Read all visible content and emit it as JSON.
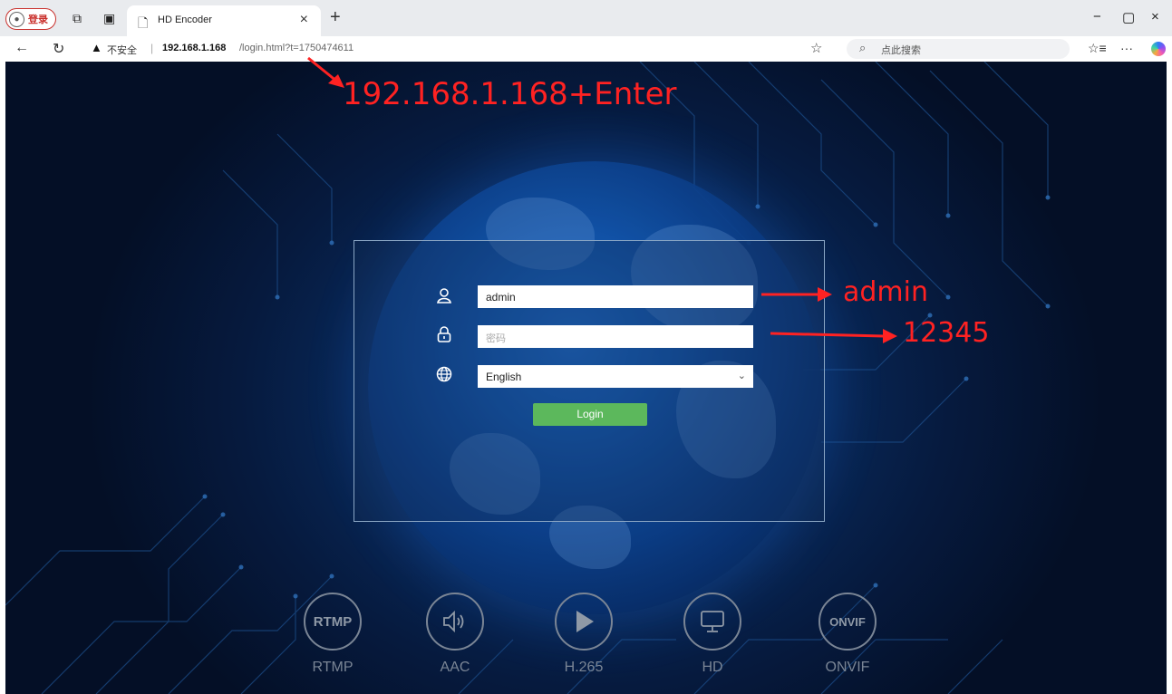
{
  "browser": {
    "profile_label": "登录",
    "tab_title": "HD Encoder",
    "tab_close": "×",
    "new_tab": "+",
    "security_label": "不安全",
    "url_host": "192.168.1.168",
    "url_path": "/login.html?t=1750474611",
    "search_placeholder": "点此搜索",
    "window_minimize": "−",
    "window_restore": "▢",
    "window_close": "×",
    "more": "···"
  },
  "login": {
    "username_value": "admin",
    "password_placeholder": "密码",
    "language_selected": "English",
    "login_button": "Login"
  },
  "features": [
    {
      "icon_text": "RTMP",
      "label": "RTMP"
    },
    {
      "icon_text": "",
      "label": "AAC"
    },
    {
      "icon_text": "",
      "label": "H.265"
    },
    {
      "icon_text": "",
      "label": "HD"
    },
    {
      "icon_text": "ONVIF",
      "label": "ONVIF"
    }
  ],
  "annotations": {
    "address_hint": "192.168.1.168+Enter",
    "username_hint": "admin",
    "password_hint": "12345",
    "color": "#ff2222"
  },
  "colors": {
    "login_button": "#5cb85c",
    "page_background": "#061a3e",
    "warning_accent": "#c9302c"
  },
  "icons": [
    "user-icon",
    "lock-icon",
    "globe-icon",
    "speaker-icon",
    "play-icon",
    "monitor-icon",
    "warning-icon",
    "star-icon",
    "search-icon"
  ]
}
